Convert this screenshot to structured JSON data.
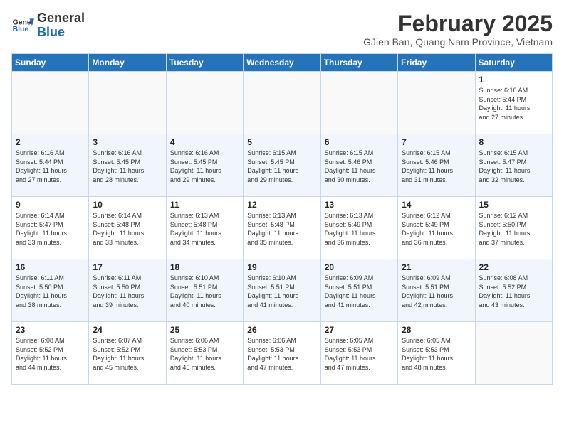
{
  "header": {
    "logo_general": "General",
    "logo_blue": "Blue",
    "title": "February 2025",
    "subtitle": "GJien Ban, Quang Nam Province, Vietnam"
  },
  "days_of_week": [
    "Sunday",
    "Monday",
    "Tuesday",
    "Wednesday",
    "Thursday",
    "Friday",
    "Saturday"
  ],
  "weeks": [
    [
      {
        "day": "",
        "info": ""
      },
      {
        "day": "",
        "info": ""
      },
      {
        "day": "",
        "info": ""
      },
      {
        "day": "",
        "info": ""
      },
      {
        "day": "",
        "info": ""
      },
      {
        "day": "",
        "info": ""
      },
      {
        "day": "1",
        "info": "Sunrise: 6:16 AM\nSunset: 5:44 PM\nDaylight: 11 hours\nand 27 minutes."
      }
    ],
    [
      {
        "day": "2",
        "info": "Sunrise: 6:16 AM\nSunset: 5:44 PM\nDaylight: 11 hours\nand 27 minutes."
      },
      {
        "day": "3",
        "info": "Sunrise: 6:16 AM\nSunset: 5:45 PM\nDaylight: 11 hours\nand 28 minutes."
      },
      {
        "day": "4",
        "info": "Sunrise: 6:16 AM\nSunset: 5:45 PM\nDaylight: 11 hours\nand 29 minutes."
      },
      {
        "day": "5",
        "info": "Sunrise: 6:15 AM\nSunset: 5:45 PM\nDaylight: 11 hours\nand 29 minutes."
      },
      {
        "day": "6",
        "info": "Sunrise: 6:15 AM\nSunset: 5:46 PM\nDaylight: 11 hours\nand 30 minutes."
      },
      {
        "day": "7",
        "info": "Sunrise: 6:15 AM\nSunset: 5:46 PM\nDaylight: 11 hours\nand 31 minutes."
      },
      {
        "day": "8",
        "info": "Sunrise: 6:15 AM\nSunset: 5:47 PM\nDaylight: 11 hours\nand 32 minutes."
      }
    ],
    [
      {
        "day": "9",
        "info": "Sunrise: 6:14 AM\nSunset: 5:47 PM\nDaylight: 11 hours\nand 33 minutes."
      },
      {
        "day": "10",
        "info": "Sunrise: 6:14 AM\nSunset: 5:48 PM\nDaylight: 11 hours\nand 33 minutes."
      },
      {
        "day": "11",
        "info": "Sunrise: 6:13 AM\nSunset: 5:48 PM\nDaylight: 11 hours\nand 34 minutes."
      },
      {
        "day": "12",
        "info": "Sunrise: 6:13 AM\nSunset: 5:48 PM\nDaylight: 11 hours\nand 35 minutes."
      },
      {
        "day": "13",
        "info": "Sunrise: 6:13 AM\nSunset: 5:49 PM\nDaylight: 11 hours\nand 36 minutes."
      },
      {
        "day": "14",
        "info": "Sunrise: 6:12 AM\nSunset: 5:49 PM\nDaylight: 11 hours\nand 36 minutes."
      },
      {
        "day": "15",
        "info": "Sunrise: 6:12 AM\nSunset: 5:50 PM\nDaylight: 11 hours\nand 37 minutes."
      }
    ],
    [
      {
        "day": "16",
        "info": "Sunrise: 6:11 AM\nSunset: 5:50 PM\nDaylight: 11 hours\nand 38 minutes."
      },
      {
        "day": "17",
        "info": "Sunrise: 6:11 AM\nSunset: 5:50 PM\nDaylight: 11 hours\nand 39 minutes."
      },
      {
        "day": "18",
        "info": "Sunrise: 6:10 AM\nSunset: 5:51 PM\nDaylight: 11 hours\nand 40 minutes."
      },
      {
        "day": "19",
        "info": "Sunrise: 6:10 AM\nSunset: 5:51 PM\nDaylight: 11 hours\nand 41 minutes."
      },
      {
        "day": "20",
        "info": "Sunrise: 6:09 AM\nSunset: 5:51 PM\nDaylight: 11 hours\nand 41 minutes."
      },
      {
        "day": "21",
        "info": "Sunrise: 6:09 AM\nSunset: 5:51 PM\nDaylight: 11 hours\nand 42 minutes."
      },
      {
        "day": "22",
        "info": "Sunrise: 6:08 AM\nSunset: 5:52 PM\nDaylight: 11 hours\nand 43 minutes."
      }
    ],
    [
      {
        "day": "23",
        "info": "Sunrise: 6:08 AM\nSunset: 5:52 PM\nDaylight: 11 hours\nand 44 minutes."
      },
      {
        "day": "24",
        "info": "Sunrise: 6:07 AM\nSunset: 5:52 PM\nDaylight: 11 hours\nand 45 minutes."
      },
      {
        "day": "25",
        "info": "Sunrise: 6:06 AM\nSunset: 5:53 PM\nDaylight: 11 hours\nand 46 minutes."
      },
      {
        "day": "26",
        "info": "Sunrise: 6:06 AM\nSunset: 5:53 PM\nDaylight: 11 hours\nand 47 minutes."
      },
      {
        "day": "27",
        "info": "Sunrise: 6:05 AM\nSunset: 5:53 PM\nDaylight: 11 hours\nand 47 minutes."
      },
      {
        "day": "28",
        "info": "Sunrise: 6:05 AM\nSunset: 5:53 PM\nDaylight: 11 hours\nand 48 minutes."
      },
      {
        "day": "",
        "info": ""
      }
    ]
  ]
}
